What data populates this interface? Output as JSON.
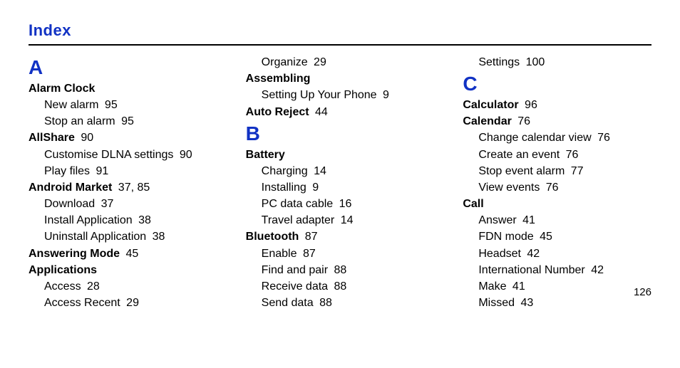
{
  "title": "Index",
  "pageNumber": "126",
  "col1": {
    "letterA": "A",
    "alarmClock": {
      "label": "Alarm Clock"
    },
    "alarmClockNewAlarm": {
      "label": "New alarm",
      "page": "95"
    },
    "alarmClockStop": {
      "label": "Stop an alarm",
      "page": "95"
    },
    "allShare": {
      "label": "AllShare",
      "page": "90"
    },
    "allShareCustomise": {
      "label": "Customise DLNA settings",
      "page": "90"
    },
    "allSharePlay": {
      "label": "Play files",
      "page": "91"
    },
    "androidMarket": {
      "label": "Android Market",
      "page": "37, 85"
    },
    "androidMarketDownload": {
      "label": "Download",
      "page": "37"
    },
    "androidMarketInstall": {
      "label": "Install Application",
      "page": "38"
    },
    "androidMarketUninstall": {
      "label": "Uninstall Application",
      "page": "38"
    },
    "answeringMode": {
      "label": "Answering Mode",
      "page": "45"
    },
    "applications": {
      "label": "Applications"
    },
    "appsAccess": {
      "label": "Access",
      "page": "28"
    },
    "appsAccessRecent": {
      "label": "Access Recent",
      "page": "29"
    }
  },
  "col2": {
    "organize": {
      "label": "Organize",
      "page": "29"
    },
    "assembling": {
      "label": "Assembling"
    },
    "assemblingSetup": {
      "label": "Setting Up Your Phone",
      "page": "9"
    },
    "autoReject": {
      "label": "Auto Reject",
      "page": "44"
    },
    "letterB": "B",
    "battery": {
      "label": "Battery"
    },
    "batteryCharging": {
      "label": "Charging",
      "page": "14"
    },
    "batteryInstalling": {
      "label": "Installing",
      "page": "9"
    },
    "batteryPcCable": {
      "label": "PC data cable",
      "page": "16"
    },
    "batteryTravel": {
      "label": "Travel adapter",
      "page": "14"
    },
    "bluetooth": {
      "label": "Bluetooth",
      "page": "87"
    },
    "btEnable": {
      "label": "Enable",
      "page": "87"
    },
    "btFindPair": {
      "label": "Find and pair",
      "page": "88"
    },
    "btReceive": {
      "label": "Receive data",
      "page": "88"
    },
    "btSend": {
      "label": "Send data",
      "page": "88"
    }
  },
  "col3": {
    "settings": {
      "label": "Settings",
      "page": "100"
    },
    "letterC": "C",
    "calculator": {
      "label": "Calculator",
      "page": "96"
    },
    "calendar": {
      "label": "Calendar",
      "page": "76"
    },
    "calChangeView": {
      "label": "Change calendar view",
      "page": "76"
    },
    "calCreate": {
      "label": "Create an event",
      "page": "76"
    },
    "calStopAlarm": {
      "label": "Stop event alarm",
      "page": "77"
    },
    "calViewEvents": {
      "label": "View events",
      "page": "76"
    },
    "call": {
      "label": "Call"
    },
    "callAnswer": {
      "label": "Answer",
      "page": "41"
    },
    "callFdn": {
      "label": "FDN mode",
      "page": "45"
    },
    "callHeadset": {
      "label": "Headset",
      "page": "42"
    },
    "callIntl": {
      "label": "International Number",
      "page": "42"
    },
    "callMake": {
      "label": "Make",
      "page": "41"
    },
    "callMissed": {
      "label": "Missed",
      "page": "43"
    }
  }
}
